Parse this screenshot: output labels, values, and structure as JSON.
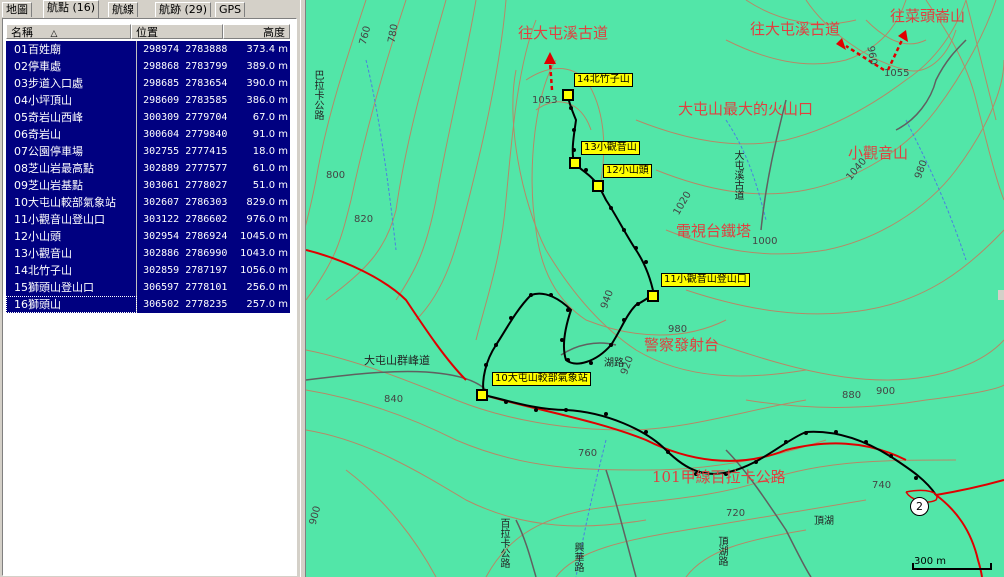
{
  "tabs": [
    "地圖",
    "航點 (16)",
    "航線",
    "航跡 (29)",
    "GPS"
  ],
  "active_tab": 1,
  "columns": [
    "名稱",
    "位置",
    "高度"
  ],
  "sort_indicator": "△",
  "waypoints": [
    {
      "name": "01百姓廟",
      "pos": "298974 2783888",
      "alt": "373.4 m"
    },
    {
      "name": "02停車處",
      "pos": "298868 2783799",
      "alt": "389.0 m"
    },
    {
      "name": "03步道入口處",
      "pos": "298685 2783654",
      "alt": "390.0 m"
    },
    {
      "name": "04小坪頂山",
      "pos": "298609 2783585",
      "alt": "386.0 m"
    },
    {
      "name": "05奇岩山西峰",
      "pos": "300309 2779704",
      "alt": "67.0 m"
    },
    {
      "name": "06奇岩山",
      "pos": "300604 2779840",
      "alt": "91.0 m"
    },
    {
      "name": "07公園停車場",
      "pos": "302755 2777415",
      "alt": "18.0 m"
    },
    {
      "name": "08芝山岩最高點",
      "pos": "302889 2777577",
      "alt": "61.0 m"
    },
    {
      "name": "09芝山岩基點",
      "pos": "303061 2778027",
      "alt": "51.0 m"
    },
    {
      "name": "10大屯山較部氣象站",
      "pos": "302607 2786303",
      "alt": "829.0 m"
    },
    {
      "name": "11小觀音山登山口",
      "pos": "303122 2786602",
      "alt": "976.0 m"
    },
    {
      "name": "12小山頭",
      "pos": "302954 2786924",
      "alt": "1045.0 m"
    },
    {
      "name": "13小觀音山",
      "pos": "302886 2786990",
      "alt": "1043.0 m"
    },
    {
      "name": "14北竹子山",
      "pos": "302859 2787197",
      "alt": "1056.0 m"
    },
    {
      "name": "15獅頭山登山口",
      "pos": "306597 2778101",
      "alt": "256.0 m"
    },
    {
      "name": "16獅頭山",
      "pos": "306502 2778235",
      "alt": "257.0 m"
    }
  ],
  "map": {
    "red_labels": [
      "往大屯溪古道",
      "往大屯溪古道",
      "往菜頭崙山",
      "大屯山最大的火山口",
      "小觀音山",
      "電視台鐵塔",
      "警察發射台",
      "101甲線百拉卡公路"
    ],
    "waypoint_labels": [
      "14北竹子山",
      "13小觀音山",
      "12小山頭",
      "11小觀音山登山口",
      "10大屯山較部氣象站"
    ],
    "contour_labels": [
      "760",
      "780",
      "800",
      "820",
      "840",
      "760",
      "740",
      "720",
      "900",
      "940",
      "980",
      "920",
      "1000",
      "1020",
      "1040",
      "980",
      "1053",
      "1055",
      "960",
      "880",
      "900"
    ],
    "road_labels": [
      "大屯山群峰道",
      "大屯溪古道",
      "巴拉卡公路",
      "百拉卡公路",
      "頂湖",
      "頂湖路",
      "興華路",
      "湖路"
    ],
    "route_marker": "2",
    "scale_label": "300 m"
  }
}
